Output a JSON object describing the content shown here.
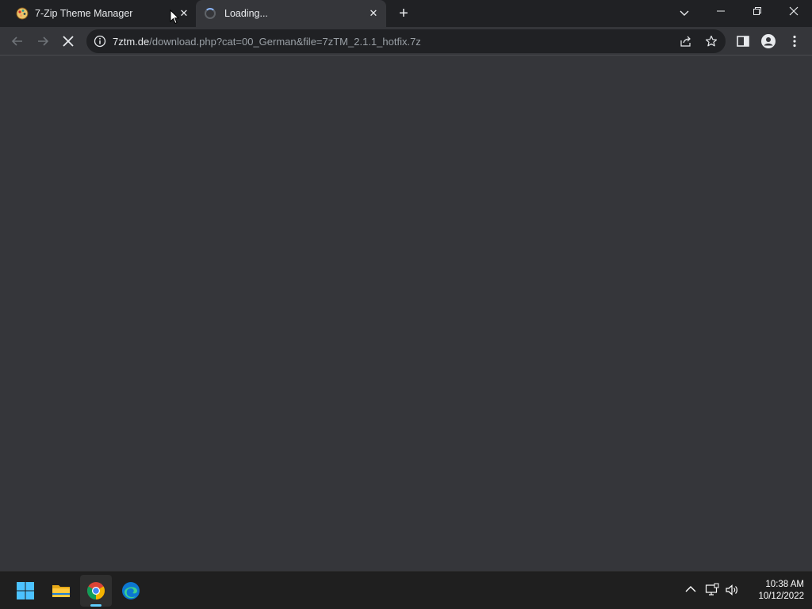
{
  "browser": {
    "tabs": [
      {
        "title": "7-Zip Theme Manager",
        "favicon": "7zip-theme-manager-icon",
        "active": false
      },
      {
        "title": "Loading...",
        "favicon": "loading-spinner-icon",
        "active": true
      }
    ],
    "address_bar": {
      "host": "7ztm.de",
      "path": "/download.php?cat=00_German&file=7zTM_2.1.1_hotfix.7z"
    },
    "loading": true
  },
  "taskbar": {
    "apps": [
      "start-icon",
      "file-explorer-icon",
      "chrome-icon",
      "edge-icon"
    ],
    "clock": {
      "time": "10:38 AM",
      "date": "10/12/2022"
    }
  },
  "colors": {
    "tabstrip_bg": "#202124",
    "toolbar_bg": "#35363a",
    "omnibox_bg": "#202124",
    "content_bg": "#35363a",
    "taskbar_bg": "#1f1f1f",
    "accent": "#60cdff"
  }
}
